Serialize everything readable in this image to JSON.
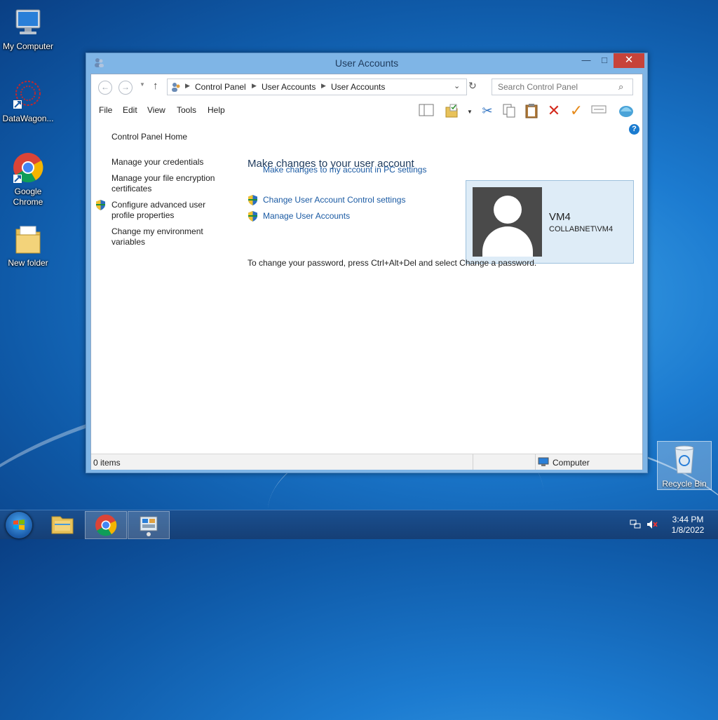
{
  "desktop": {
    "icons": [
      {
        "label": "My Computer"
      },
      {
        "label": "DataWagon..."
      },
      {
        "label": "Google Chrome"
      },
      {
        "label": "New folder"
      },
      {
        "label": "Recycle Bin"
      }
    ]
  },
  "window": {
    "title": "User Accounts",
    "controls": {
      "minimize": "—",
      "maximize": "□",
      "close": "✕"
    },
    "address": {
      "breadcrumbs": [
        "Control Panel",
        "User Accounts",
        "User Accounts"
      ]
    },
    "search": {
      "placeholder": "Search Control Panel"
    },
    "menu": [
      "File",
      "Edit",
      "View",
      "Tools",
      "Help"
    ],
    "left_pane": {
      "items": [
        "Control Panel Home",
        "Manage your credentials",
        "Manage your file encryption certificates",
        "Configure advanced user profile properties",
        "Change my environment variables"
      ]
    },
    "main": {
      "title": "Make changes to your user account",
      "links": [
        "Make changes to my account in PC settings",
        "Change User Account Control settings",
        "Manage User Accounts"
      ],
      "note": "To change your password, press Ctrl+Alt+Del and select Change a password."
    },
    "user": {
      "name": "VM4",
      "domain": "COLLABNET\\VM4"
    },
    "status": {
      "items": "0 items",
      "location": "Computer"
    }
  },
  "taskbar": {
    "time": "3:44 PM",
    "date": "1/8/2022"
  },
  "colors": {
    "link": "#1a5aa3",
    "close": "#c7433a",
    "title": "#1e3a5c"
  }
}
